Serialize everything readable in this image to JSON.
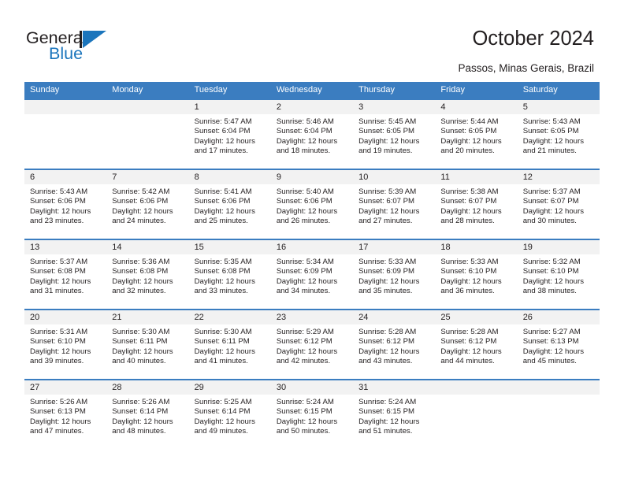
{
  "brand": {
    "name_part1": "General",
    "name_part2": "Blue",
    "logo_icon": "triangle-flag-icon",
    "accent_color": "#1b75bc"
  },
  "header": {
    "title": "October 2024",
    "location": "Passos, Minas Gerais, Brazil"
  },
  "calendar": {
    "header_bg_color": "#3b7dc0",
    "daynum_bg_color": "#f2f2f2",
    "weekday_headers": [
      "Sunday",
      "Monday",
      "Tuesday",
      "Wednesday",
      "Thursday",
      "Friday",
      "Saturday"
    ],
    "weeks": [
      [
        {
          "day": "",
          "sunrise": "",
          "sunset": "",
          "daylight_line1": "",
          "daylight_line2": ""
        },
        {
          "day": "",
          "sunrise": "",
          "sunset": "",
          "daylight_line1": "",
          "daylight_line2": ""
        },
        {
          "day": "1",
          "sunrise": "Sunrise: 5:47 AM",
          "sunset": "Sunset: 6:04 PM",
          "daylight_line1": "Daylight: 12 hours",
          "daylight_line2": "and 17 minutes."
        },
        {
          "day": "2",
          "sunrise": "Sunrise: 5:46 AM",
          "sunset": "Sunset: 6:04 PM",
          "daylight_line1": "Daylight: 12 hours",
          "daylight_line2": "and 18 minutes."
        },
        {
          "day": "3",
          "sunrise": "Sunrise: 5:45 AM",
          "sunset": "Sunset: 6:05 PM",
          "daylight_line1": "Daylight: 12 hours",
          "daylight_line2": "and 19 minutes."
        },
        {
          "day": "4",
          "sunrise": "Sunrise: 5:44 AM",
          "sunset": "Sunset: 6:05 PM",
          "daylight_line1": "Daylight: 12 hours",
          "daylight_line2": "and 20 minutes."
        },
        {
          "day": "5",
          "sunrise": "Sunrise: 5:43 AM",
          "sunset": "Sunset: 6:05 PM",
          "daylight_line1": "Daylight: 12 hours",
          "daylight_line2": "and 21 minutes."
        }
      ],
      [
        {
          "day": "6",
          "sunrise": "Sunrise: 5:43 AM",
          "sunset": "Sunset: 6:06 PM",
          "daylight_line1": "Daylight: 12 hours",
          "daylight_line2": "and 23 minutes."
        },
        {
          "day": "7",
          "sunrise": "Sunrise: 5:42 AM",
          "sunset": "Sunset: 6:06 PM",
          "daylight_line1": "Daylight: 12 hours",
          "daylight_line2": "and 24 minutes."
        },
        {
          "day": "8",
          "sunrise": "Sunrise: 5:41 AM",
          "sunset": "Sunset: 6:06 PM",
          "daylight_line1": "Daylight: 12 hours",
          "daylight_line2": "and 25 minutes."
        },
        {
          "day": "9",
          "sunrise": "Sunrise: 5:40 AM",
          "sunset": "Sunset: 6:06 PM",
          "daylight_line1": "Daylight: 12 hours",
          "daylight_line2": "and 26 minutes."
        },
        {
          "day": "10",
          "sunrise": "Sunrise: 5:39 AM",
          "sunset": "Sunset: 6:07 PM",
          "daylight_line1": "Daylight: 12 hours",
          "daylight_line2": "and 27 minutes."
        },
        {
          "day": "11",
          "sunrise": "Sunrise: 5:38 AM",
          "sunset": "Sunset: 6:07 PM",
          "daylight_line1": "Daylight: 12 hours",
          "daylight_line2": "and 28 minutes."
        },
        {
          "day": "12",
          "sunrise": "Sunrise: 5:37 AM",
          "sunset": "Sunset: 6:07 PM",
          "daylight_line1": "Daylight: 12 hours",
          "daylight_line2": "and 30 minutes."
        }
      ],
      [
        {
          "day": "13",
          "sunrise": "Sunrise: 5:37 AM",
          "sunset": "Sunset: 6:08 PM",
          "daylight_line1": "Daylight: 12 hours",
          "daylight_line2": "and 31 minutes."
        },
        {
          "day": "14",
          "sunrise": "Sunrise: 5:36 AM",
          "sunset": "Sunset: 6:08 PM",
          "daylight_line1": "Daylight: 12 hours",
          "daylight_line2": "and 32 minutes."
        },
        {
          "day": "15",
          "sunrise": "Sunrise: 5:35 AM",
          "sunset": "Sunset: 6:08 PM",
          "daylight_line1": "Daylight: 12 hours",
          "daylight_line2": "and 33 minutes."
        },
        {
          "day": "16",
          "sunrise": "Sunrise: 5:34 AM",
          "sunset": "Sunset: 6:09 PM",
          "daylight_line1": "Daylight: 12 hours",
          "daylight_line2": "and 34 minutes."
        },
        {
          "day": "17",
          "sunrise": "Sunrise: 5:33 AM",
          "sunset": "Sunset: 6:09 PM",
          "daylight_line1": "Daylight: 12 hours",
          "daylight_line2": "and 35 minutes."
        },
        {
          "day": "18",
          "sunrise": "Sunrise: 5:33 AM",
          "sunset": "Sunset: 6:10 PM",
          "daylight_line1": "Daylight: 12 hours",
          "daylight_line2": "and 36 minutes."
        },
        {
          "day": "19",
          "sunrise": "Sunrise: 5:32 AM",
          "sunset": "Sunset: 6:10 PM",
          "daylight_line1": "Daylight: 12 hours",
          "daylight_line2": "and 38 minutes."
        }
      ],
      [
        {
          "day": "20",
          "sunrise": "Sunrise: 5:31 AM",
          "sunset": "Sunset: 6:10 PM",
          "daylight_line1": "Daylight: 12 hours",
          "daylight_line2": "and 39 minutes."
        },
        {
          "day": "21",
          "sunrise": "Sunrise: 5:30 AM",
          "sunset": "Sunset: 6:11 PM",
          "daylight_line1": "Daylight: 12 hours",
          "daylight_line2": "and 40 minutes."
        },
        {
          "day": "22",
          "sunrise": "Sunrise: 5:30 AM",
          "sunset": "Sunset: 6:11 PM",
          "daylight_line1": "Daylight: 12 hours",
          "daylight_line2": "and 41 minutes."
        },
        {
          "day": "23",
          "sunrise": "Sunrise: 5:29 AM",
          "sunset": "Sunset: 6:12 PM",
          "daylight_line1": "Daylight: 12 hours",
          "daylight_line2": "and 42 minutes."
        },
        {
          "day": "24",
          "sunrise": "Sunrise: 5:28 AM",
          "sunset": "Sunset: 6:12 PM",
          "daylight_line1": "Daylight: 12 hours",
          "daylight_line2": "and 43 minutes."
        },
        {
          "day": "25",
          "sunrise": "Sunrise: 5:28 AM",
          "sunset": "Sunset: 6:12 PM",
          "daylight_line1": "Daylight: 12 hours",
          "daylight_line2": "and 44 minutes."
        },
        {
          "day": "26",
          "sunrise": "Sunrise: 5:27 AM",
          "sunset": "Sunset: 6:13 PM",
          "daylight_line1": "Daylight: 12 hours",
          "daylight_line2": "and 45 minutes."
        }
      ],
      [
        {
          "day": "27",
          "sunrise": "Sunrise: 5:26 AM",
          "sunset": "Sunset: 6:13 PM",
          "daylight_line1": "Daylight: 12 hours",
          "daylight_line2": "and 47 minutes."
        },
        {
          "day": "28",
          "sunrise": "Sunrise: 5:26 AM",
          "sunset": "Sunset: 6:14 PM",
          "daylight_line1": "Daylight: 12 hours",
          "daylight_line2": "and 48 minutes."
        },
        {
          "day": "29",
          "sunrise": "Sunrise: 5:25 AM",
          "sunset": "Sunset: 6:14 PM",
          "daylight_line1": "Daylight: 12 hours",
          "daylight_line2": "and 49 minutes."
        },
        {
          "day": "30",
          "sunrise": "Sunrise: 5:24 AM",
          "sunset": "Sunset: 6:15 PM",
          "daylight_line1": "Daylight: 12 hours",
          "daylight_line2": "and 50 minutes."
        },
        {
          "day": "31",
          "sunrise": "Sunrise: 5:24 AM",
          "sunset": "Sunset: 6:15 PM",
          "daylight_line1": "Daylight: 12 hours",
          "daylight_line2": "and 51 minutes."
        },
        {
          "day": "",
          "sunrise": "",
          "sunset": "",
          "daylight_line1": "",
          "daylight_line2": ""
        },
        {
          "day": "",
          "sunrise": "",
          "sunset": "",
          "daylight_line1": "",
          "daylight_line2": ""
        }
      ]
    ]
  }
}
